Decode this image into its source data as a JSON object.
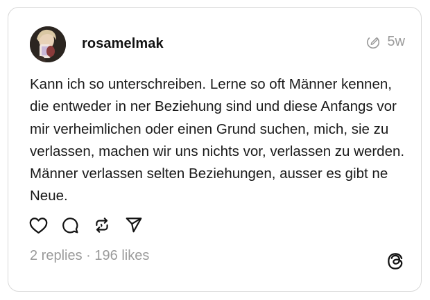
{
  "post": {
    "username": "rosamelmak",
    "timestamp": "5w",
    "text": "Kann ich so unterschreiben. Lerne so oft Männer kennen, die entweder in ner Beziehung sind und diese Anfangs vor mir verheimlichen oder einen Grund suchen, mich, sie zu verlassen, machen wir uns nichts vor, verlassen zu werden. Männer verlassen selten Beziehungen, ausser es gibt ne Neue.",
    "replies_count": "2 replies",
    "separator": "·",
    "likes_count": "196 likes"
  },
  "icons": {
    "edited": "edited-pencil-circle-icon",
    "like": "heart-icon",
    "reply": "comment-bubble-icon",
    "repost": "repost-icon",
    "share": "send-icon",
    "brand": "threads-logo-icon"
  },
  "colors": {
    "text": "#1a1a1a",
    "muted": "#9a9a9a",
    "border": "#d8d8d8"
  }
}
